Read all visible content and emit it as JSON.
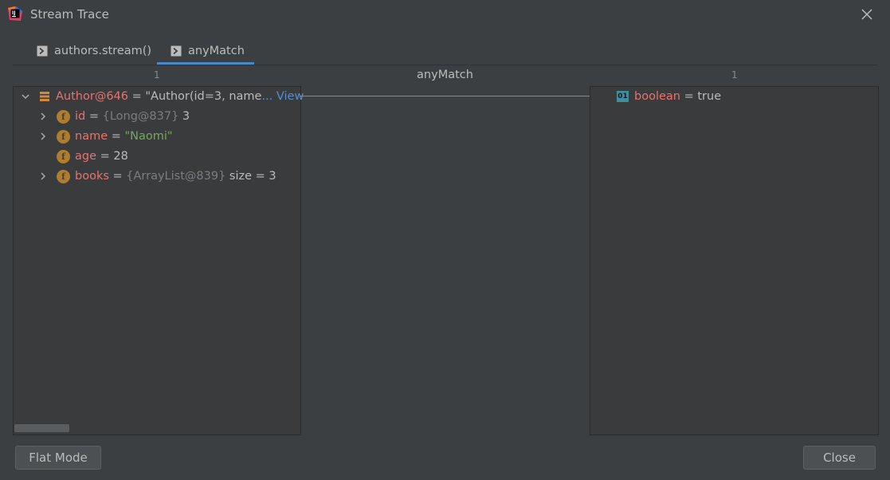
{
  "window": {
    "title": "Stream Trace"
  },
  "tabs": [
    {
      "label": "authors.stream()"
    },
    {
      "label": "anyMatch"
    }
  ],
  "trace": {
    "left_count": "1",
    "center_label": "anyMatch",
    "right_count": "1"
  },
  "left_tree": {
    "root": {
      "name": "Author@646",
      "eq": " = ",
      "value": "\"Author(id=3, name",
      "ellipsis_link": "... View"
    },
    "fields": [
      {
        "name": "id",
        "eq": " = ",
        "ref": "{Long@837}",
        "value": " 3"
      },
      {
        "name": "name",
        "eq": " = ",
        "value": "\"Naomi\""
      },
      {
        "name": "age",
        "eq": " = ",
        "value": "28"
      },
      {
        "name": "books",
        "eq": " = ",
        "ref": "{ArrayList@839}",
        "value": " size = 3"
      }
    ],
    "field_icon_letter": "f"
  },
  "right_tree": {
    "result": {
      "icon_text": "01",
      "name": "boolean",
      "eq": " = ",
      "value": "true"
    }
  },
  "buttons": {
    "flat_mode": "Flat Mode",
    "close": "Close"
  },
  "colors": {
    "accent": "#4a88c7",
    "key": "#e8736d",
    "string": "#79a55d",
    "link": "#5b8dcf",
    "field_icon": "#b07d2e"
  }
}
